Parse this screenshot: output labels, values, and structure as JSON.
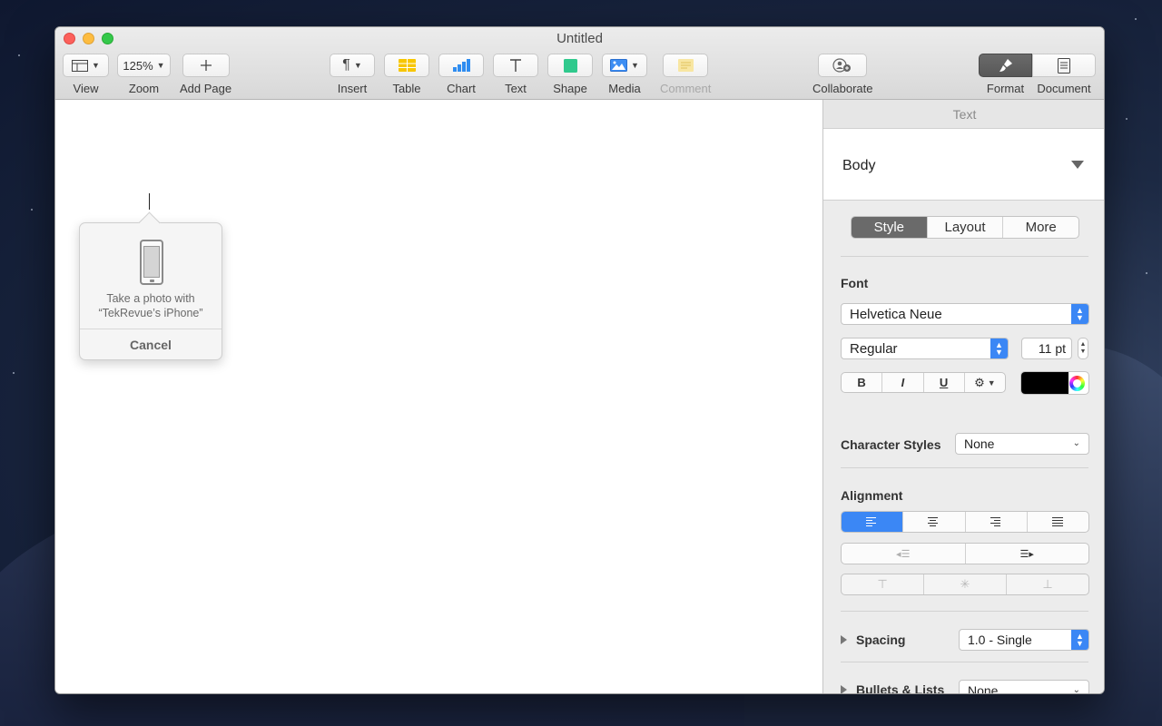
{
  "window": {
    "title": "Untitled"
  },
  "toolbar": {
    "view": {
      "label": "View"
    },
    "zoom": {
      "label": "Zoom",
      "value": "125%"
    },
    "add_page": {
      "label": "Add Page"
    },
    "insert": {
      "label": "Insert"
    },
    "table": {
      "label": "Table"
    },
    "chart": {
      "label": "Chart"
    },
    "text": {
      "label": "Text"
    },
    "shape": {
      "label": "Shape"
    },
    "media": {
      "label": "Media"
    },
    "comment": {
      "label": "Comment"
    },
    "collaborate": {
      "label": "Collaborate"
    },
    "format": {
      "label": "Format"
    },
    "document": {
      "label": "Document"
    }
  },
  "popover": {
    "message_line1": "Take a photo with",
    "message_line2": "“TekRevue’s iPhone”",
    "cancel_label": "Cancel"
  },
  "inspector": {
    "header": "Text",
    "paragraph_style": "Body",
    "tabs": [
      "Style",
      "Layout",
      "More"
    ],
    "font": {
      "section_label": "Font",
      "family": "Helvetica Neue",
      "typeface": "Regular",
      "size": "11 pt",
      "bold": "B",
      "italic": "I",
      "underline": "U",
      "color": "#000000"
    },
    "character_styles": {
      "label": "Character Styles",
      "value": "None"
    },
    "alignment": {
      "section_label": "Alignment"
    },
    "spacing": {
      "label": "Spacing",
      "value": "1.0 - Single"
    },
    "bullets": {
      "label": "Bullets & Lists",
      "value": "None"
    }
  },
  "colors": {
    "accent": "#3b87f5",
    "selected_segment": "#6a6a6a"
  }
}
